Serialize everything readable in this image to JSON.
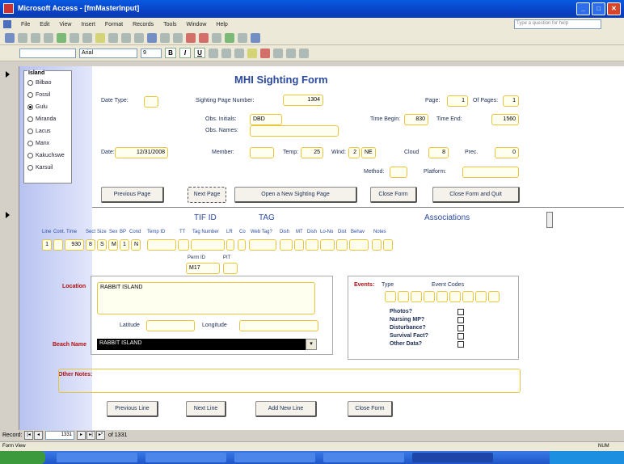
{
  "window": {
    "title": "Microsoft Access - [fmMasterInput]"
  },
  "menu": {
    "items": [
      "File",
      "Edit",
      "View",
      "Insert",
      "Format",
      "Records",
      "Tools",
      "Window",
      "Help"
    ],
    "help_placeholder": "Type a question for help"
  },
  "toolbar": {
    "font": "Arial",
    "size": "9",
    "bold": "B",
    "italic": "I",
    "underline": "U"
  },
  "island": {
    "title": "Island",
    "options": [
      "Bilbao",
      "Fossil",
      "Gulu",
      "Miranda",
      "Lacus",
      "Manx",
      "Kakuchswe",
      "Karsuil"
    ],
    "selected_index": 2
  },
  "form": {
    "title": "MHI Sighting Form",
    "date_type_label": "Date Type:",
    "date_type_value": "",
    "sighting_page_label": "Sighting Page Number:",
    "sighting_page_value": "1304",
    "page_label": "Page:",
    "page_value": "1",
    "of_pages_label": "Of Pages:",
    "of_pages_value": "1",
    "obs_initials_label": "Obs. Initials:",
    "obs_initials_value": "DBD",
    "obs_names_label": "Obs. Names:",
    "obs_names_value": "",
    "time_begin_label": "Time Begin:",
    "time_begin_value": "830",
    "time_end_label": "Time End:",
    "time_end_value": "1560",
    "date_label": "Date:",
    "date_value": "12/31/2008",
    "member_label": "Member:",
    "member_value": "",
    "temp_label": "Temp:",
    "temp_value": "25",
    "wind_label": "Wind:",
    "wind_value1": "2",
    "wind_value2": "NE",
    "cloud_label": "Cloud",
    "cloud_value": "8",
    "prec_label": "Prec.",
    "prec_value": "0",
    "method_label": "Method:",
    "method_value": "",
    "platform_label": "Platform:",
    "platform_value": ""
  },
  "buttons": {
    "previous_page": "Previous Page",
    "next_page": "Next Page",
    "open_new_page": "Open a New Sighting Page",
    "close_form": "Close Form",
    "close_quit": "Close Form and Quit",
    "previous_line": "Previous Line",
    "next_line": "Next Line",
    "add_new_line": "Add New Line",
    "close_form2": "Close Form"
  },
  "detail": {
    "tif_header": "TIF ID",
    "tag_header": "TAG",
    "assoc_header": "Associations",
    "columns": [
      "Line",
      "Cont.",
      "Time",
      "Sect",
      "Size",
      "Sex",
      "BP",
      "Cond",
      "Temp ID",
      "TT",
      "Tag Number",
      "LR",
      "Co",
      "Web Tag?",
      "Dish",
      "MT",
      "Dish",
      "Lo-No",
      "Dist",
      "Behav",
      "Notes"
    ],
    "row_values": [
      "1",
      "",
      "930",
      "8",
      "S",
      "M",
      "1",
      "N"
    ],
    "permid_label": "Perm ID",
    "permid_value": "M17",
    "pit_label": "PIT",
    "location_label": "Location",
    "location_value": "RABBIT ISLAND",
    "latitude_label": "Latitude",
    "longitude_label": "Longitude",
    "beach_label": "Beach Name",
    "beach_value": "RABBIT ISLAND",
    "events_label": "Events:",
    "type_label": "Type",
    "event_codes_label": "Event Codes",
    "checks": [
      "Photos?",
      "Nursing MP?",
      "Disturbance?",
      "Survival Fact?",
      "Other Data?"
    ],
    "other_notes_label": "Other Notes:"
  },
  "recordnav": {
    "label": "Record:",
    "current": "1331",
    "total": "of 1331"
  },
  "statusbar": {
    "left": "Form View",
    "right": "NUM"
  }
}
